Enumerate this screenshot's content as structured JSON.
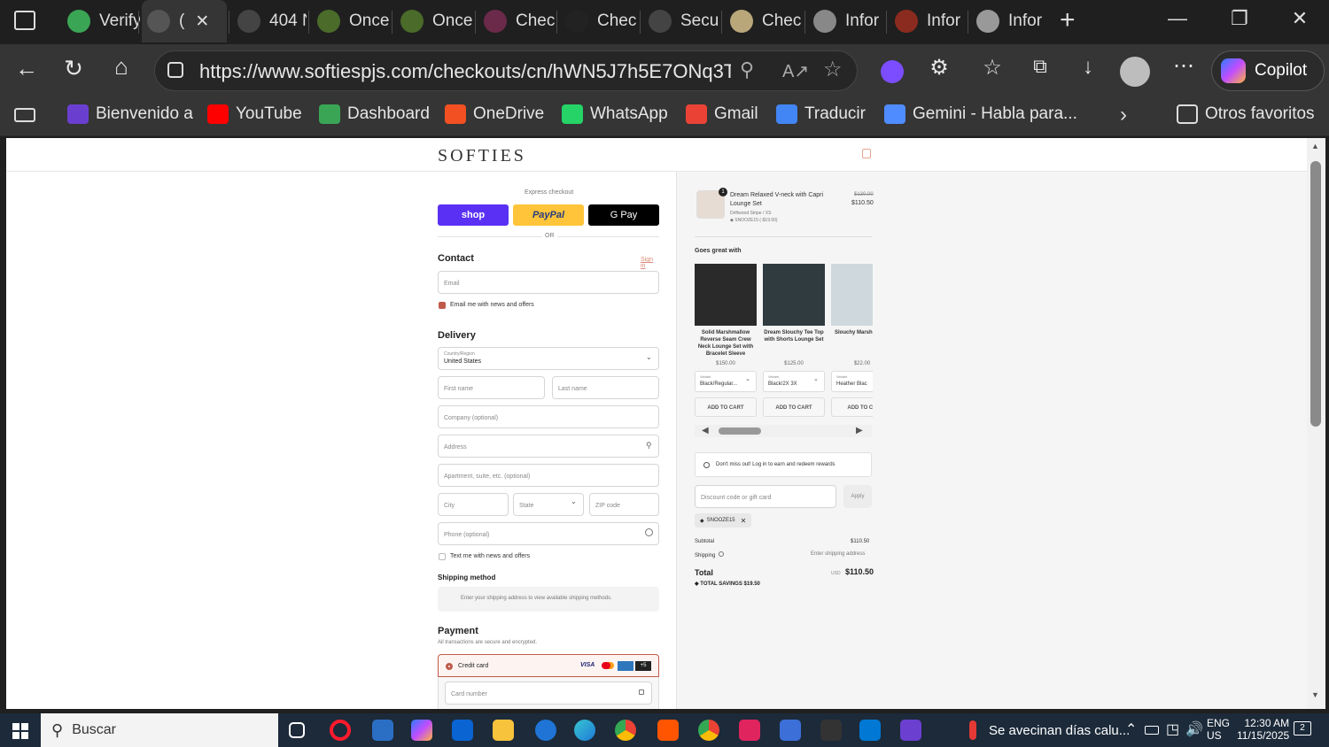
{
  "tabs": [
    {
      "label": "Verify",
      "color": "#3aa655"
    },
    {
      "label": "(",
      "color": "#555",
      "active": true
    },
    {
      "label": "404 N",
      "color": "#444"
    },
    {
      "label": "Once",
      "color": "#4a6b2a"
    },
    {
      "label": "Once",
      "color": "#4a6b2a"
    },
    {
      "label": "Chec",
      "color": "#6b2a4a"
    },
    {
      "label": "Chec",
      "color": "#222"
    },
    {
      "label": "Secu",
      "color": "#444"
    },
    {
      "label": "Chec",
      "color": "#b9a77a"
    },
    {
      "label": "Infor",
      "color": "#888"
    },
    {
      "label": "Infor",
      "color": "#8b2b1f"
    },
    {
      "label": "Infor",
      "color": "#999"
    }
  ],
  "url": "https://www.softiespjs.com/checkouts/cn/hWN5J7h5E7ONq3T...",
  "copilot_label": "Copilot",
  "bookmarks": [
    {
      "label": "Bienvenido a",
      "color": "#6a3fd0"
    },
    {
      "label": "YouTube",
      "color": "#ff0000"
    },
    {
      "label": "Dashboard",
      "color": "#3aa655"
    },
    {
      "label": "OneDrive",
      "color": "#f25022"
    },
    {
      "label": "WhatsApp",
      "color": "#25d366"
    },
    {
      "label": "Gmail",
      "color": "#ea4335"
    },
    {
      "label": "Traducir",
      "color": "#4285f4"
    },
    {
      "label": "Gemini - Habla para...",
      "color": "#4f8cff"
    }
  ],
  "other_favorites": "Otros favoritos",
  "checkout": {
    "logo": "SOFTIES",
    "express_label": "Express checkout",
    "shop_label": "shop",
    "paypal_label": "PayPal",
    "gpay_label": "G Pay",
    "or_label": "OR",
    "contact_title": "Contact",
    "sign_in": "Sign in",
    "email_placeholder": "Email",
    "email_news": "Email me with news and offers",
    "delivery_title": "Delivery",
    "country_label": "Country/Region",
    "country_value": "United States",
    "first_name": "First name",
    "last_name": "Last name",
    "company": "Company (optional)",
    "address": "Address",
    "apartment": "Apartment, suite, etc. (optional)",
    "city": "City",
    "state": "State",
    "zip": "ZIP code",
    "phone": "Phone (optional)",
    "text_news": "Text me with news and offers",
    "shipping_method_title": "Shipping method",
    "shipping_note": "Enter your shipping address to view available shipping methods.",
    "payment_title": "Payment",
    "payment_secure": "All transactions are secure and encrypted.",
    "credit_card": "Credit card",
    "card_more": "+5",
    "card_number": "Card number"
  },
  "summary": {
    "item_name": "Dream Relaxed V-neck with Capri Lounge Set",
    "item_variant": "Driftwood Stripe / XS",
    "item_discount": "SNOOZE15 (-$19.50)",
    "item_qty": "1",
    "item_old_price": "$130.00",
    "item_price": "$110.50",
    "goes_great": "Goes great with",
    "recs": [
      {
        "name": "Solid Marshmallow Reverse Seam Crew Neck Lounge Set with Bracelet Sleeve",
        "price": "$150.00",
        "variant_label": "Variant",
        "variant": "Black/Regular...",
        "cta": "ADD TO CART"
      },
      {
        "name": "Dream Slouchy Tee Top with Shorts Lounge Set",
        "price": "$125.00",
        "variant_label": "Variant",
        "variant": "Black/2X 3X",
        "cta": "ADD TO CART"
      },
      {
        "name": "Slouchy Marsh Socks",
        "price": "$22.00",
        "variant_label": "Variant",
        "variant": "Heather Blac",
        "cta": "ADD TO CA"
      }
    ],
    "rewards": "Don't miss out! Log in to earn and redeem rewards",
    "discount_placeholder": "Discount code or gift card",
    "apply": "Apply",
    "code_chip": "SNOOZE15",
    "subtotal_label": "Subtotal",
    "subtotal": "$110.50",
    "shipping_label": "Shipping",
    "shipping_value": "Enter shipping address",
    "total_label": "Total",
    "currency": "USD",
    "total": "$110.50",
    "savings_label": "TOTAL SAVINGS",
    "savings": "$19.50"
  },
  "taskbar": {
    "search": "Buscar",
    "weather": "Se avecinan días calu...",
    "lang1": "ENG",
    "lang2": "US",
    "time": "12:30 AM",
    "date": "11/15/2025",
    "notif": "2"
  }
}
